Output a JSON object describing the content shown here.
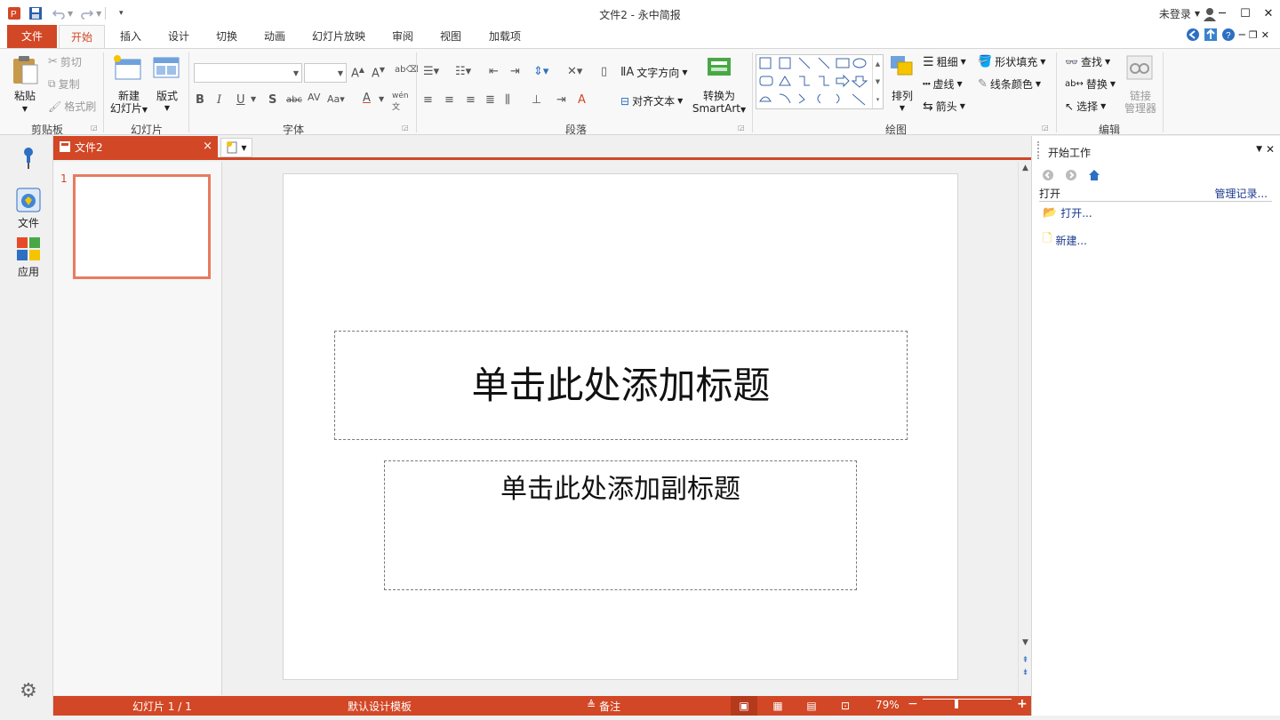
{
  "app": {
    "title": "文件2 - 永中简报",
    "login_label": "未登录",
    "icons": [
      "app-logo-icon",
      "save-icon",
      "undo-icon",
      "redo-icon",
      "customize-qa-icon"
    ]
  },
  "window_controls": {
    "minimize": "─",
    "maximize": "☐",
    "close": "✕"
  },
  "ribbon": {
    "tabs": [
      {
        "label": "文件"
      },
      {
        "label": "开始"
      },
      {
        "label": "插入"
      },
      {
        "label": "设计"
      },
      {
        "label": "切换"
      },
      {
        "label": "动画"
      },
      {
        "label": "幻灯片放映"
      },
      {
        "label": "审阅"
      },
      {
        "label": "视图"
      },
      {
        "label": "加载项"
      }
    ],
    "active_tab": "开始",
    "clipboard": {
      "paste": "粘贴",
      "cut": "剪切",
      "copy": "复制",
      "format_painter": "格式刷",
      "group": "剪贴板"
    },
    "slides": {
      "new_slide_line1": "新建",
      "new_slide_line2": "幻灯片",
      "layout": "版式",
      "group": "幻灯片"
    },
    "font": {
      "group": "字体",
      "font_name": "",
      "font_size": ""
    },
    "paragraph": {
      "group": "段落",
      "text_direction": "文字方向",
      "align_text": "对齐文本",
      "convert_line1": "转换为",
      "convert_line2": "SmartArt"
    },
    "drawing": {
      "group": "绘图",
      "arrange": "排列",
      "weight": "粗细",
      "dash": "虚线",
      "arrow": "箭头",
      "shape_fill": "形状填充",
      "line_color": "线条颜色"
    },
    "editing": {
      "group": "编辑",
      "find": "查找",
      "replace": "替换",
      "select": "选择",
      "link_manager_line1": "链接",
      "link_manager_line2": "管理器"
    }
  },
  "left_nav": {
    "file": "文件",
    "apps": "应用"
  },
  "doc_tab": {
    "name": "文件2",
    "close": "×"
  },
  "thumbnails": [
    {
      "number": "1"
    }
  ],
  "slide": {
    "title_placeholder": "单击此处添加标题",
    "subtitle_placeholder": "单击此处添加副标题"
  },
  "task_pane": {
    "title": "开始工作",
    "open_section": "打开",
    "manage_records": "管理记录...",
    "open_link": "打开...",
    "new_link": "新建..."
  },
  "status": {
    "slide_count": "幻灯片 1 / 1",
    "template": "默认设计模板",
    "notes": "备注",
    "zoom": "79%",
    "zoom_minus": "−",
    "zoom_plus": "+"
  },
  "colors": {
    "accent": "#d24726",
    "thumb_border": "#e87b5e",
    "link": "#1a3a8c"
  }
}
